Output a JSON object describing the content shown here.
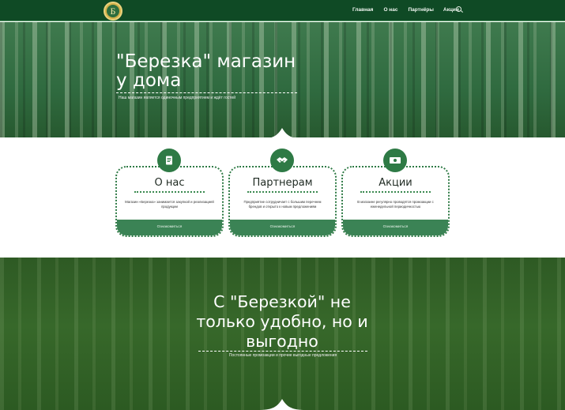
{
  "nav": {
    "logo_letter": "Б",
    "items": [
      "Главная",
      "О нас",
      "Партнёры",
      "Акции"
    ],
    "search_icon": "search-icon"
  },
  "hero": {
    "title_line1": "\"Березка\" магазин",
    "title_line2": "у дома",
    "subtitle": "Наш магазин является одиночным предприятием и ждёт гостей"
  },
  "cards": [
    {
      "icon": "book-icon",
      "title": "О нас",
      "text": "Магазин «Березка» занимается закупкой и реализацией продукции",
      "button": "Ознакомиться"
    },
    {
      "icon": "handshake-icon",
      "title": "Партнерам",
      "text": "Предприятие сотрудничает с большим перечнем брендов и открыто к новым предложениям",
      "button": "Ознакомиться"
    },
    {
      "icon": "money-icon",
      "title": "Акции",
      "text": "В магазине регулярно проводятся промоакции с еженедельной периодичностью",
      "button": "Ознакомиться"
    }
  ],
  "promo": {
    "title": "С \"Березкой\" не только удобно, но и выгодно",
    "subtitle": "Постоянные промоакции и прочие выгодные предложения"
  },
  "colors": {
    "nav_bg": "#0f4a25",
    "accent": "#2e7a45",
    "button": "#3b8355",
    "logo_gold": "#d3b24a"
  }
}
